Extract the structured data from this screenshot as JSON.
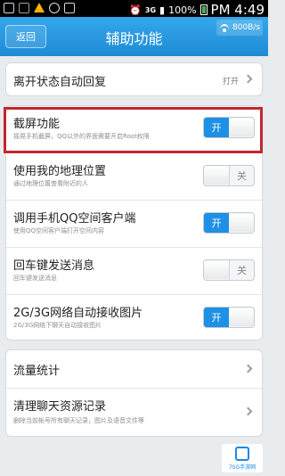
{
  "status_bar": {
    "network": "3G",
    "battery": "100%",
    "time": "PM 4:49"
  },
  "header": {
    "back_label": "返回",
    "title": "辅助功能",
    "traffic": "800B/s"
  },
  "card1": {
    "title": "离开状态自动回复",
    "value": "打开"
  },
  "card2": {
    "rows": [
      {
        "title": "截屏功能",
        "subtitle": "摇晃手机截屏，QQ以外的界面需要开启Root权限",
        "toggle": "on"
      },
      {
        "title": "使用我的地理位置",
        "subtitle": "通过地理位置查看附近的人",
        "toggle": "off"
      },
      {
        "title": "调用手机QQ空间客户端",
        "subtitle": "使用QQ空间客户端打开空间内容",
        "toggle": "on"
      },
      {
        "title": "回车键发送消息",
        "subtitle": "回车键发送消息",
        "toggle": "off"
      },
      {
        "title": "2G/3G网络自动接收图片",
        "subtitle": "2G/3G网络下聊天自动接收图片",
        "toggle": "on"
      }
    ],
    "on_label": "开",
    "off_label": "关"
  },
  "card3": {
    "rows": [
      {
        "title": "流量统计"
      },
      {
        "title": "清理聊天资源记录",
        "subtitle": "删除当前帐号所有聊天记录，图片及语音文件等"
      }
    ]
  },
  "watermark": {
    "text": "7SG手游网"
  },
  "colors": {
    "accent": "#1e90e6",
    "title_bar": "#2b9be3",
    "highlight": "#c0282d"
  }
}
